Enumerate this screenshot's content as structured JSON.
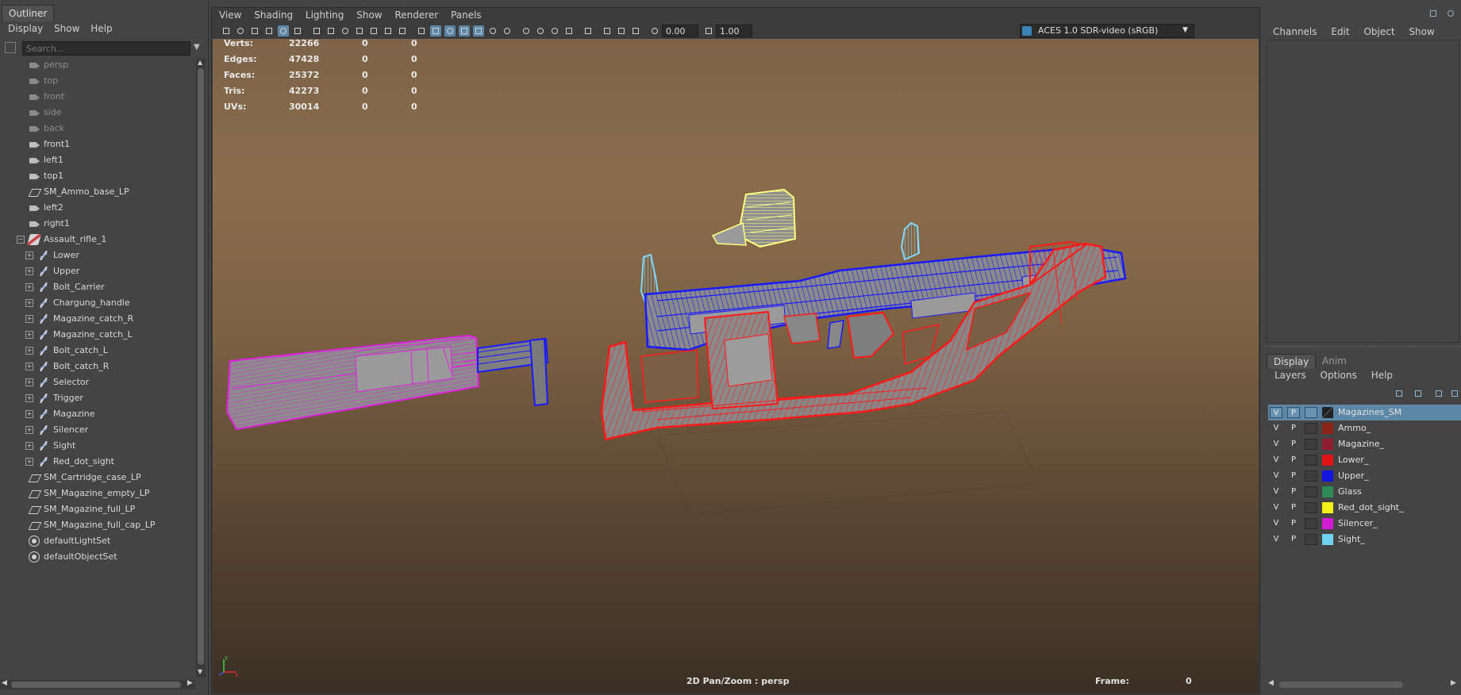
{
  "outliner": {
    "title": "Outliner",
    "menu": [
      "Display",
      "Show",
      "Help"
    ],
    "search_placeholder": "Search...",
    "items": [
      {
        "label": "persp",
        "icon": "camera-icon",
        "dim": true,
        "level": 0
      },
      {
        "label": "top",
        "icon": "camera-icon",
        "dim": true,
        "level": 0
      },
      {
        "label": "front",
        "icon": "camera-icon",
        "dim": true,
        "level": 0
      },
      {
        "label": "side",
        "icon": "camera-icon",
        "dim": true,
        "level": 0
      },
      {
        "label": "back",
        "icon": "camera-icon",
        "dim": true,
        "level": 0
      },
      {
        "label": "front1",
        "icon": "camera-icon",
        "dim": false,
        "level": 0
      },
      {
        "label": "left1",
        "icon": "camera-icon",
        "dim": false,
        "level": 0
      },
      {
        "label": "top1",
        "icon": "camera-icon",
        "dim": false,
        "level": 0
      },
      {
        "label": "SM_Ammo_base_LP",
        "icon": "mesh-icon",
        "dim": false,
        "level": 0
      },
      {
        "label": "left2",
        "icon": "camera-icon",
        "dim": false,
        "level": 0
      },
      {
        "label": "right1",
        "icon": "camera-icon",
        "dim": false,
        "level": 0
      },
      {
        "label": "Assault_rifle_1",
        "icon": "group-icon",
        "dim": false,
        "level": 0,
        "expander": "−"
      },
      {
        "label": "Lower",
        "icon": "transform-icon",
        "dim": false,
        "level": 1,
        "expander": "+"
      },
      {
        "label": "Upper",
        "icon": "transform-icon",
        "dim": false,
        "level": 1,
        "expander": "+"
      },
      {
        "label": "Bolt_Carrier",
        "icon": "transform-icon",
        "dim": false,
        "level": 1,
        "expander": "+"
      },
      {
        "label": "Chargung_handle",
        "icon": "transform-icon",
        "dim": false,
        "level": 1,
        "expander": "+"
      },
      {
        "label": "Magazine_catch_R",
        "icon": "transform-icon",
        "dim": false,
        "level": 1,
        "expander": "+"
      },
      {
        "label": "Magazine_catch_L",
        "icon": "transform-icon",
        "dim": false,
        "level": 1,
        "expander": "+"
      },
      {
        "label": "Bolt_catch_L",
        "icon": "transform-icon",
        "dim": false,
        "level": 1,
        "expander": "+"
      },
      {
        "label": "Bolt_catch_R",
        "icon": "transform-icon",
        "dim": false,
        "level": 1,
        "expander": "+"
      },
      {
        "label": "Selector",
        "icon": "transform-icon",
        "dim": false,
        "level": 1,
        "expander": "+"
      },
      {
        "label": "Trigger",
        "icon": "transform-icon",
        "dim": false,
        "level": 1,
        "expander": "+"
      },
      {
        "label": "Magazine",
        "icon": "transform-icon",
        "dim": false,
        "level": 1,
        "expander": "+"
      },
      {
        "label": "Silencer",
        "icon": "transform-icon",
        "dim": false,
        "level": 1,
        "expander": "+"
      },
      {
        "label": "Sight",
        "icon": "transform-icon",
        "dim": false,
        "level": 1,
        "expander": "+"
      },
      {
        "label": "Red_dot_sight",
        "icon": "transform-icon",
        "dim": false,
        "level": 1,
        "expander": "+"
      },
      {
        "label": "SM_Cartridge_case_LP",
        "icon": "mesh-icon",
        "dim": false,
        "level": 0
      },
      {
        "label": "SM_Magazine_empty_LP",
        "icon": "mesh-icon",
        "dim": false,
        "level": 0
      },
      {
        "label": "SM_Magazine_full_LP",
        "icon": "mesh-icon",
        "dim": false,
        "level": 0
      },
      {
        "label": "SM_Magazine_full_cap_LP",
        "icon": "mesh-icon",
        "dim": false,
        "level": 0
      },
      {
        "label": "defaultLightSet",
        "icon": "set-icon",
        "dim": false,
        "level": 0
      },
      {
        "label": "defaultObjectSet",
        "icon": "set-icon",
        "dim": false,
        "level": 0
      }
    ]
  },
  "viewport": {
    "menu": [
      "View",
      "Shading",
      "Lighting",
      "Show",
      "Renderer",
      "Panels"
    ],
    "exposure": "0.00",
    "gamma": "1.00",
    "color_space": "ACES 1.0 SDR-video (sRGB)",
    "hud": [
      {
        "label": "Verts:",
        "v1": "22266",
        "v2": "0",
        "v3": "0"
      },
      {
        "label": "Edges:",
        "v1": "47428",
        "v2": "0",
        "v3": "0"
      },
      {
        "label": "Faces:",
        "v1": "25372",
        "v2": "0",
        "v3": "0"
      },
      {
        "label": "Tris:",
        "v1": "42273",
        "v2": "0",
        "v3": "0"
      },
      {
        "label": "UVs:",
        "v1": "30014",
        "v2": "0",
        "v3": "0"
      }
    ],
    "camera_status": "2D Pan/Zoom : persp",
    "frame_label": "Frame:",
    "frame_value": "0",
    "wire_colors": {
      "lower": "#ff1a1a",
      "upper": "#1a1aff",
      "silencer": "#e020e0",
      "red_dot_sight": "#ffff80",
      "sight": "#7fd8ff"
    }
  },
  "channel_box": {
    "menu": [
      "Channels",
      "Edit",
      "Object",
      "Show"
    ]
  },
  "layer_editor": {
    "tabs": [
      "Display",
      "Anim"
    ],
    "menu": [
      "Layers",
      "Options",
      "Help"
    ],
    "layers": [
      {
        "name": "Magazines_SM",
        "v": "V",
        "p": "P",
        "color": "#444444",
        "selected": true
      },
      {
        "name": "Ammo_",
        "v": "V",
        "p": "P",
        "color": "#8b2318",
        "selected": false
      },
      {
        "name": "Magazine_",
        "v": "V",
        "p": "P",
        "color": "#8f1e32",
        "selected": false
      },
      {
        "name": "Lower_",
        "v": "V",
        "p": "P",
        "color": "#e01414",
        "selected": false
      },
      {
        "name": "Upper_",
        "v": "V",
        "p": "P",
        "color": "#1414e0",
        "selected": false
      },
      {
        "name": "Glass",
        "v": "V",
        "p": "P",
        "color": "#2e8b57",
        "selected": false
      },
      {
        "name": "Red_dot_sight_",
        "v": "V",
        "p": "P",
        "color": "#f2f21a",
        "selected": false
      },
      {
        "name": "Silencer_",
        "v": "V",
        "p": "P",
        "color": "#d21ad2",
        "selected": false
      },
      {
        "name": "Sight_",
        "v": "V",
        "p": "P",
        "color": "#6ed2f0",
        "selected": false
      }
    ]
  }
}
